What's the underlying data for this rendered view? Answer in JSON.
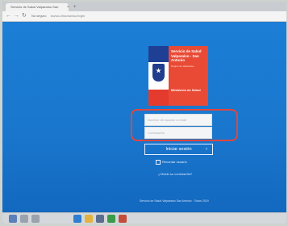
{
  "browser": {
    "tab_title": "Servicio de Salud Valparaíso San",
    "tab_close": "×",
    "new_tab": "+",
    "nav": {
      "back": "←",
      "forward": "→",
      "reload": "↻"
    },
    "secure_label": "No seguro",
    "url": "ssvsa.cl/ssvsa/sso/login"
  },
  "logo": {
    "title": "Servicio de Salud Valparaíso - San Antonio",
    "subtitle": "Región de Valparaíso",
    "ministry": "Ministerio de Salud"
  },
  "login": {
    "username_placeholder": "Nombre de usuario o email",
    "password_placeholder": "Contraseña",
    "submit_label": "Iniciar sesión",
    "submit_arrow": "›",
    "remember_label": "Recordar usuario",
    "forgot_label": "¿Olvidó su contraseña?"
  },
  "footer": {
    "text": "Servicio de Salud Valparaíso San Antonio · Todos 2019"
  },
  "colors": {
    "page_bg": "#1c7ed6",
    "highlight": "#e0473e",
    "logo_red": "#e94a35",
    "logo_blue": "#1e3f93"
  },
  "taskbar": {
    "icons": [
      "start-icon",
      "search-icon",
      "task-view-icon",
      "edge-icon",
      "explorer-icon",
      "store-icon",
      "chrome-icon",
      "app-icon"
    ]
  }
}
